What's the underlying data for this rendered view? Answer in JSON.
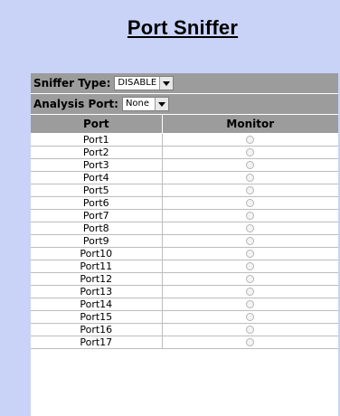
{
  "title": "Port Sniffer",
  "controls": {
    "sniffer_type_label": "Sniffer Type:",
    "sniffer_type_value": "DISABLE",
    "analysis_port_label": "Analysis Port:",
    "analysis_port_value": "None"
  },
  "table": {
    "headers": [
      "Port",
      "Monitor"
    ],
    "rows": [
      "Port1",
      "Port2",
      "Port3",
      "Port4",
      "Port5",
      "Port6",
      "Port7",
      "Port8",
      "Port9",
      "Port10",
      "Port11",
      "Port12",
      "Port13",
      "Port14",
      "Port15",
      "Port16",
      "Port17"
    ]
  },
  "colors": {
    "background": "#c9d3f7",
    "header_gray": "#9c9c9c"
  }
}
